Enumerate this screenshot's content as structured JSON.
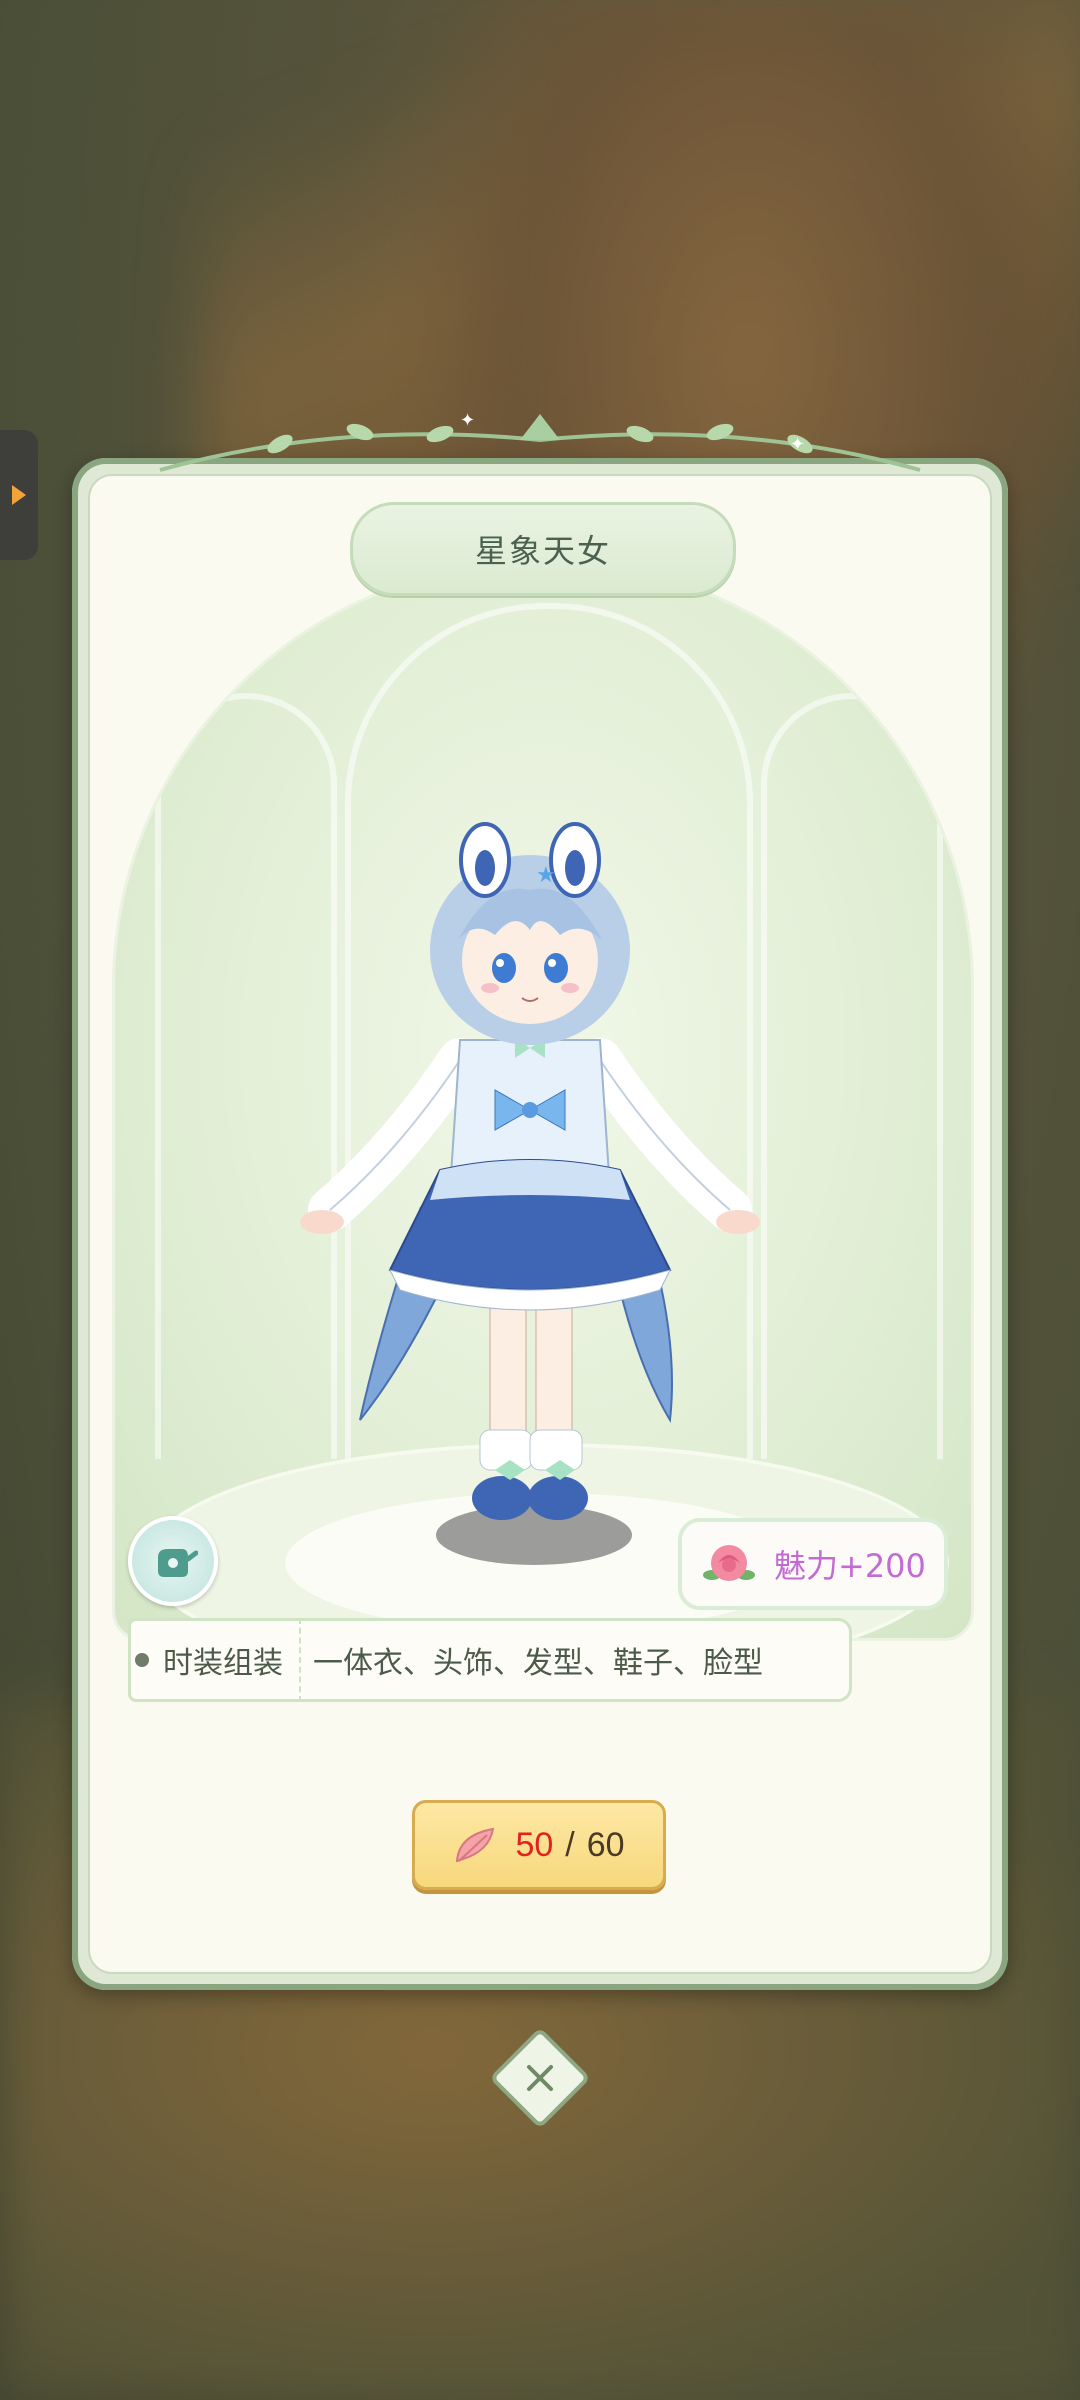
{
  "outfit": {
    "title": "星象天女",
    "charm_text": "魅力+200",
    "set_label": "时装组装",
    "set_parts": "一体衣、头饰、发型、鞋子、脸型"
  },
  "cost": {
    "owned": "50",
    "separator": "/",
    "required": "60"
  },
  "icons": {
    "side_tab": "arrow-right-icon",
    "pose_button": "watering-can-icon",
    "charm": "rose-icon",
    "currency": "feather-icon",
    "close": "close-icon"
  },
  "colors": {
    "charm_text": "#c36bd4",
    "owned_count": "#e0231f",
    "cost_button": "#f7d87c",
    "card_border": "#8aa680"
  }
}
